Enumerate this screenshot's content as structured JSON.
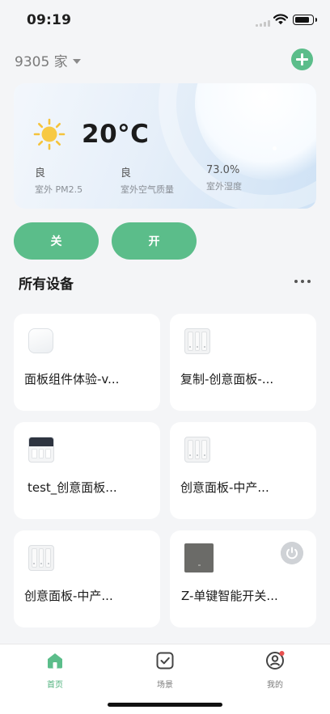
{
  "status_bar": {
    "time": "09:19"
  },
  "header": {
    "home_name": "9305 家",
    "add_icon": "plus-circle-icon"
  },
  "weather": {
    "icon": "sun-icon",
    "temperature": "20°C",
    "metrics": [
      {
        "value": "良",
        "label": "室外 PM2.5"
      },
      {
        "value": "良",
        "label": "室外空气质量"
      },
      {
        "value": "73.0%",
        "label": "室外湿度"
      }
    ]
  },
  "controls": {
    "off_label": "关",
    "on_label": "开"
  },
  "devices_section": {
    "title": "所有设备",
    "more_icon": "more-dots-icon"
  },
  "devices": [
    {
      "name": "面板组件体验-v...",
      "icon": "cube-panel-icon"
    },
    {
      "name": "复制-创意面板-...",
      "icon": "triple-switch-icon"
    },
    {
      "name": "test_创意面板...",
      "icon": "screen-panel-icon"
    },
    {
      "name": "创意面板-中产...",
      "icon": "triple-switch-icon"
    },
    {
      "name": "创意面板-中产...",
      "icon": "triple-switch-icon"
    },
    {
      "name": "Z-单键智能开关...",
      "icon": "dark-switch-icon",
      "power_icon": "power-icon"
    }
  ],
  "tabbar": {
    "tabs": [
      {
        "label": "首页",
        "icon": "home-icon",
        "active": true
      },
      {
        "label": "场景",
        "icon": "scene-check-icon",
        "active": false
      },
      {
        "label": "我的",
        "icon": "profile-icon",
        "active": false,
        "badge": true
      }
    ]
  },
  "colors": {
    "accent": "#5bbd8a",
    "badge": "#e8504f",
    "background": "#f4f5f7"
  }
}
